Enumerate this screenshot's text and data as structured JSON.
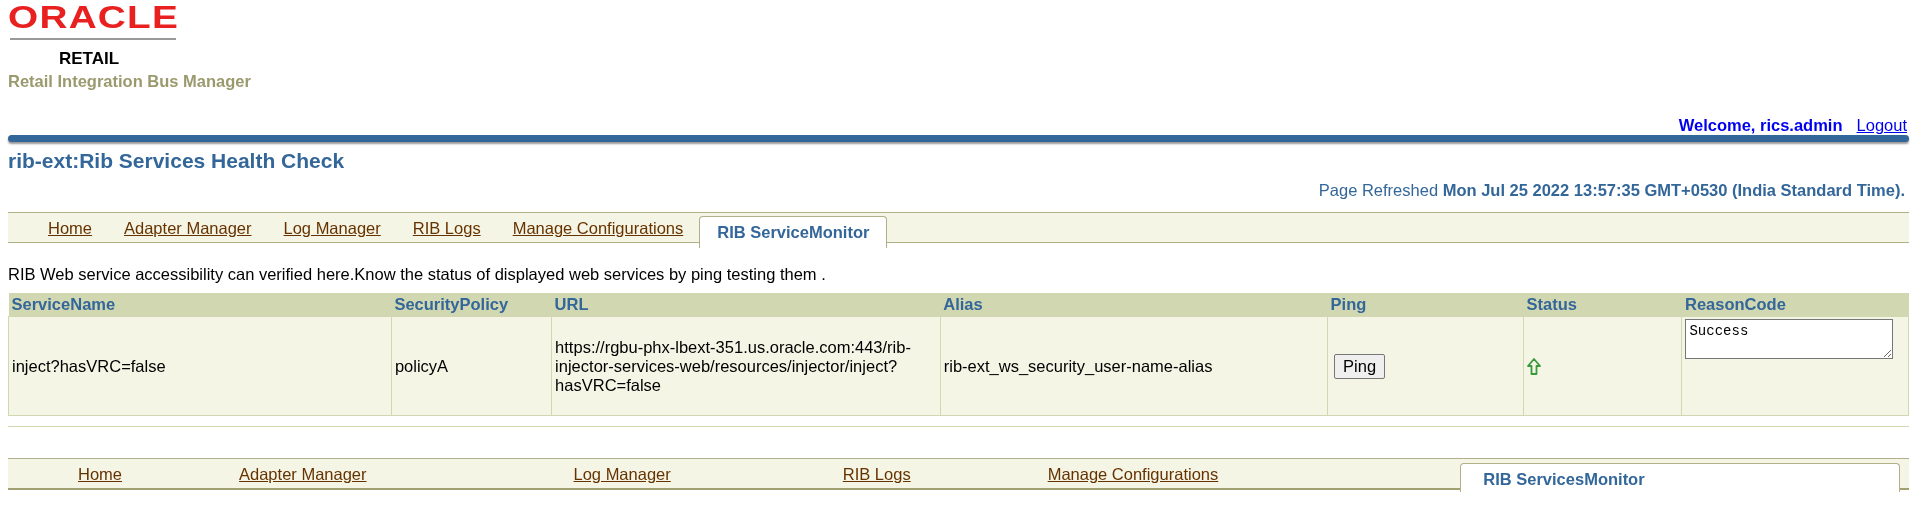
{
  "header": {
    "logo": "ORACLE",
    "logo_sub": "RETAIL",
    "app_name": "Retail Integration Bus Manager"
  },
  "user_bar": {
    "welcome": "Welcome, rics.admin",
    "logout": "Logout"
  },
  "page_title": "rib-ext:Rib Services Health Check",
  "refresh": {
    "label": "Page Refreshed",
    "time": "Mon Jul 25 2022 13:57:35 GMT+0530 (India Standard Time)."
  },
  "top_tabs": [
    {
      "label": "Home",
      "selected": false
    },
    {
      "label": "Adapter Manager",
      "selected": false
    },
    {
      "label": "Log Manager",
      "selected": false
    },
    {
      "label": "RIB Logs",
      "selected": false
    },
    {
      "label": "Manage Configurations",
      "selected": false
    },
    {
      "label": "RIB ServiceMonitor",
      "selected": true
    }
  ],
  "description": "RIB Web service accessibility can verified here.Know the status of displayed web services by ping testing them .",
  "table": {
    "columns": [
      "ServiceName",
      "SecurityPolicy",
      "URL",
      "Alias",
      "Ping",
      "Status",
      "ReasonCode"
    ],
    "rows": [
      {
        "service_name": "inject?hasVRC=false",
        "security_policy": "policyA",
        "url": "https://rgbu-phx-lbext-351.us.oracle.com:443/rib-injector-services-web/resources/injector/inject?hasVRC=false",
        "alias": "rib-ext_ws_security_user-name-alias",
        "ping": "Ping",
        "status_up": true,
        "reason_code": "Success"
      }
    ]
  },
  "bottom_tabs": [
    {
      "label": "Home",
      "selected": false
    },
    {
      "label": "Adapter Manager",
      "selected": false
    },
    {
      "label": "Log Manager",
      "selected": false
    },
    {
      "label": "RIB Logs",
      "selected": false
    },
    {
      "label": "Manage Configurations",
      "selected": false
    },
    {
      "label": "RIB ServicesMonitor",
      "selected": true
    }
  ]
}
